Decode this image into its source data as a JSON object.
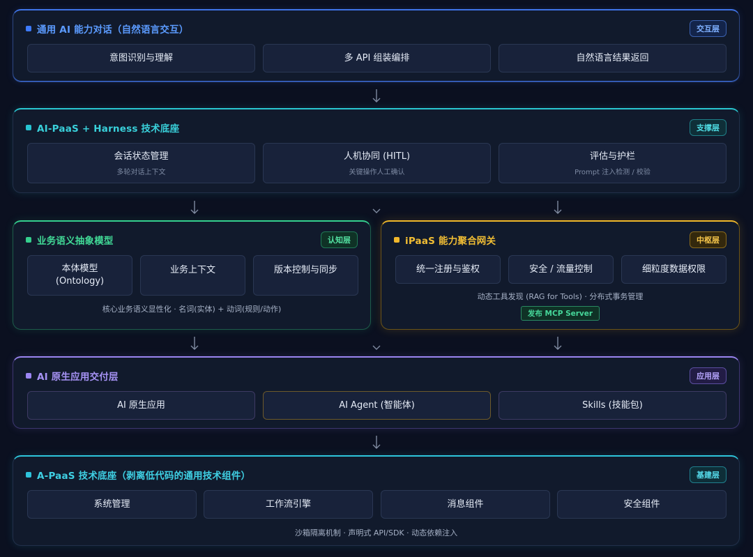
{
  "layers": {
    "interaction": {
      "title": "通用 AI 能力对话（自然语言交互）",
      "badge": "交互层",
      "items": [
        "意图识别与理解",
        "多 API 组装编排",
        "自然语言结果返回"
      ]
    },
    "support": {
      "title": "AI-PaaS + Harness 技术底座",
      "badge": "支撑层",
      "items": [
        {
          "label": "会话状态管理",
          "sub": "多轮对话上下文"
        },
        {
          "label": "人机协同 (HITL)",
          "sub": "关键操作人工确认"
        },
        {
          "label": "评估与护栏",
          "sub": "Prompt 注入检测 / 校验"
        }
      ]
    },
    "cognition": {
      "title": "业务语义抽象模型",
      "badge": "认知层",
      "items": [
        "本体模型\n(Ontology)",
        "业务上下文",
        "版本控制与同步"
      ],
      "note": "核心业务语义显性化 · 名词(实体) + 动词(规则/动作)"
    },
    "hub": {
      "title": "iPaaS 能力聚合网关",
      "badge": "中枢层",
      "items": [
        "统一注册与鉴权",
        "安全 / 流量控制",
        "细粒度数据权限"
      ],
      "note": "动态工具发现 (RAG for Tools) · 分布式事务管理",
      "tag": "发布 MCP Server"
    },
    "application": {
      "title": "AI 原生应用交付层",
      "badge": "应用层",
      "items": [
        "AI 原生应用",
        "AI Agent (智能体)",
        "Skills (技能包)"
      ]
    },
    "foundation": {
      "title": "A-PaaS 技术底座（剥离低代码的通用技术组件）",
      "badge": "基建层",
      "items": [
        "系统管理",
        "工作流引擎",
        "消息组件",
        "安全组件"
      ],
      "note": "沙箱隔离机制 · 声明式 API/SDK · 动态依赖注入"
    }
  },
  "colors": {
    "interaction": "#3e7bff",
    "support": "#27c4d2",
    "cognition": "#35cf8e",
    "hub": "#f0b72c",
    "application": "#9c86f4",
    "foundation": "#2ec3dc"
  },
  "icons": [
    "arrow-down-icon"
  ]
}
